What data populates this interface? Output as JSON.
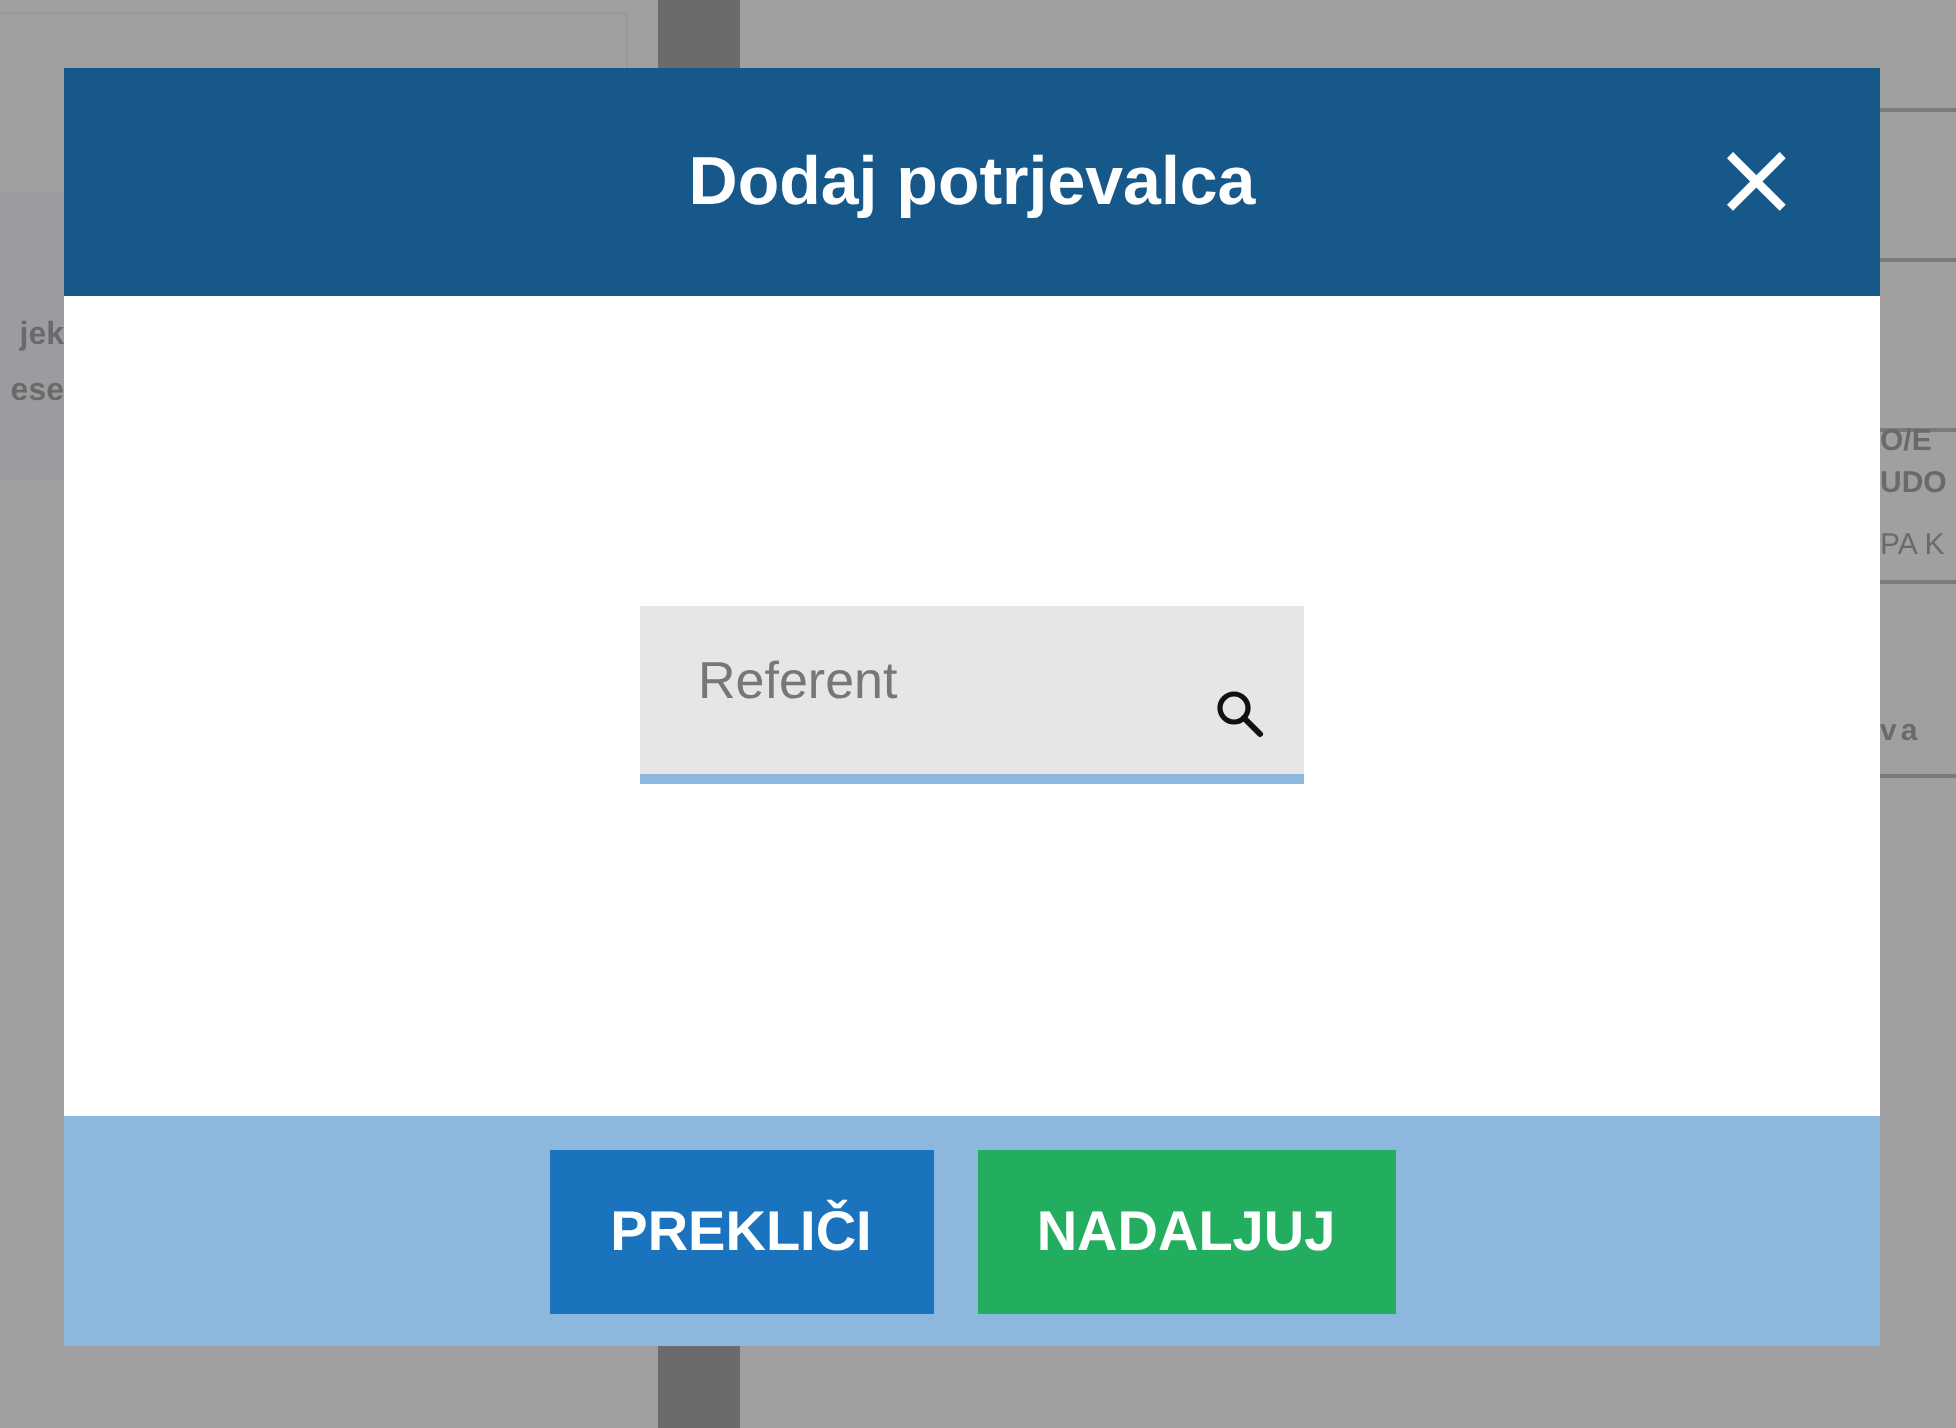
{
  "background": {
    "left_texts": [
      "jek",
      "ese"
    ],
    "right_texts": [
      "O/E",
      "UDO",
      "PA K",
      "va"
    ]
  },
  "dialog": {
    "title": "Dodaj potrjevalca",
    "close": "×",
    "search": {
      "placeholder": "Referent"
    },
    "buttons": [
      {
        "label": "PREKLIČI",
        "kind": "cancel"
      },
      {
        "label": "NADALJUJ",
        "kind": "confirm"
      }
    ]
  }
}
